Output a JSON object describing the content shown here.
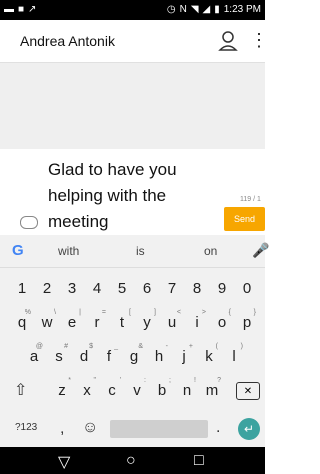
{
  "status_bar": {
    "time": "1:23 PM",
    "icons_left": [
      "sms-icon",
      "image-icon",
      "missed-call-icon"
    ],
    "icons_right": [
      "alarm-icon",
      "nfc-icon",
      "wifi-icon",
      "lte-icon",
      "signal-icon",
      "battery-icon"
    ]
  },
  "app_bar": {
    "title": "Andrea Antonik",
    "person_icon": "person-icon",
    "more_icon": "more-vert-icon"
  },
  "compose": {
    "message_text": "Glad to have you helping with the meeting",
    "char_counter": "119 / 1",
    "send_label": "Send"
  },
  "keyboard": {
    "suggestions": [
      "with",
      "is",
      "on"
    ],
    "numbers": [
      "1",
      "2",
      "3",
      "4",
      "5",
      "6",
      "7",
      "8",
      "9",
      "0"
    ],
    "row1": [
      "q",
      "w",
      "e",
      "r",
      "t",
      "y",
      "u",
      "i",
      "o",
      "p"
    ],
    "row2": [
      "a",
      "s",
      "d",
      "f",
      "g",
      "h",
      "j",
      "k",
      "l"
    ],
    "row3": [
      "z",
      "x",
      "c",
      "v",
      "b",
      "n",
      "m"
    ],
    "row1_hints": [
      "%",
      "\\",
      "|",
      "=",
      "[",
      "]",
      "<",
      ">",
      "{",
      "}"
    ],
    "row2_hints": [
      "@",
      "#",
      "$",
      "_",
      "&",
      "-",
      "+",
      "(",
      ")"
    ],
    "row3_hints": [
      "*",
      "\"",
      "'",
      ":",
      ";",
      "!",
      "?"
    ],
    "symbols_label": "?123",
    "comma": ",",
    "period": "."
  }
}
